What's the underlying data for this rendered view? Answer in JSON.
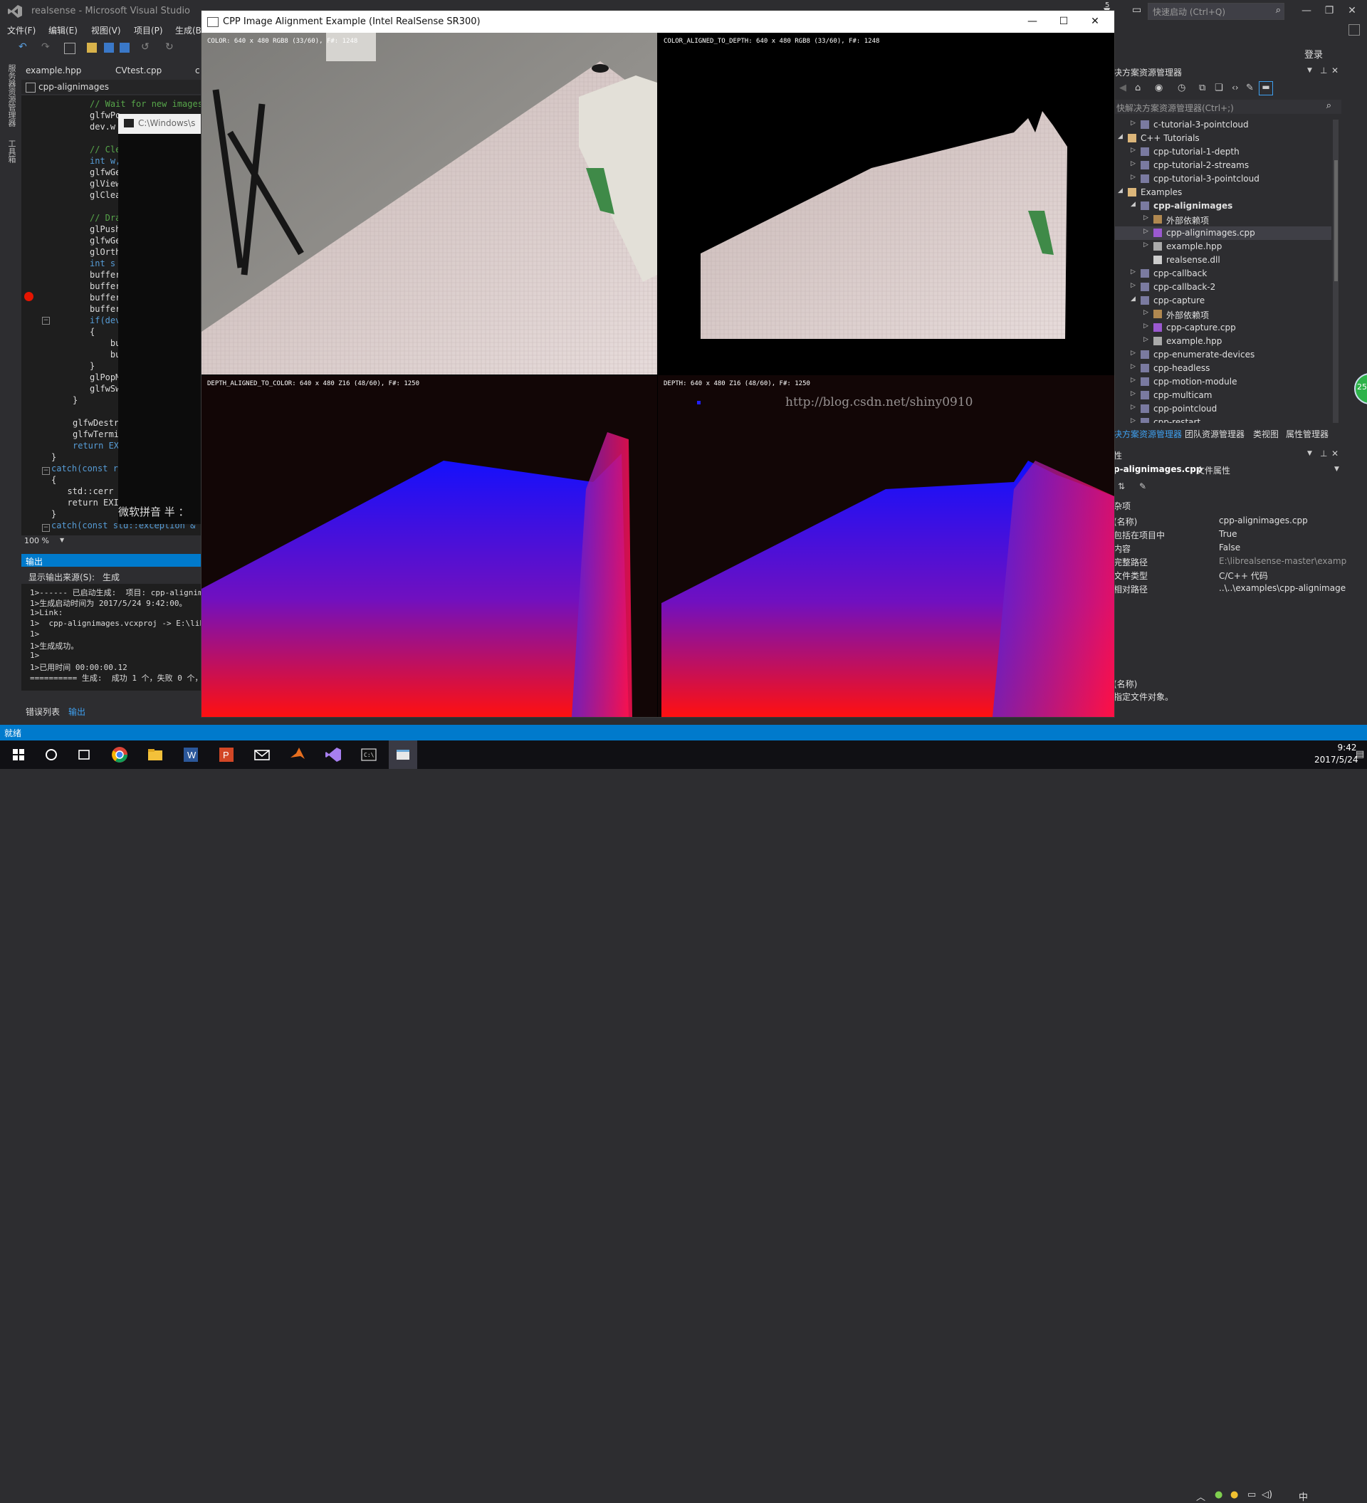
{
  "vs": {
    "title": "realsense - Microsoft Visual Studio",
    "quick_launch_placeholder": "快速启动 (Ctrl+Q)",
    "notification_count": "5",
    "login": "登录",
    "menu": [
      "文件(F)",
      "编辑(E)",
      "视图(V)",
      "项目(P)",
      "生成(B"
    ],
    "left_strip": [
      "服务器资源管理器",
      "工具箱"
    ],
    "doc_tabs": [
      "example.hpp",
      "CVtest.cpp",
      "c"
    ],
    "nav_label": "cpp-alignimages",
    "code_lines": [
      "// Wait for new images",
      "glfwPo",
      "dev.w",
      "",
      "// Cle",
      "int w,",
      "glfwGe",
      "glView",
      "glClea",
      "",
      "// Dra",
      "glPush",
      "glfwGe",
      "glOrth",
      "int s",
      "buffer",
      "buffer",
      "buffer",
      "buffer",
      "if(dev",
      "{",
      "    bu",
      "    bu",
      "}",
      "glPopM",
      "glfwSw",
      "}",
      "",
      "glfwDestro",
      "glfwTermin",
      "return EXI",
      "}",
      "catch(const ra",
      "{",
      "  std::cerr",
      "  return EXI",
      "}",
      "catch(const std::exception & e"
    ],
    "console_chip": "C:\\Windows\\s",
    "ime": "微软拼音 半 ：",
    "zoom": "100 %",
    "output": {
      "title": "输出",
      "source_label": "显示输出来源(S):",
      "source_value": "生成",
      "lines": [
        "1>------ 已启动生成:  项目: cpp-alignim",
        "1>生成启动时间为 2017/5/24 9:42:00。",
        "1>Link:",
        "1>  cpp-alignimages.vcxproj -> E:\\libre",
        "1>",
        "1>生成成功。",
        "1>",
        "1>已用时间 00:00:00.12",
        "========== 生成:  成功 1 个，失败 0 个，"
      ]
    },
    "bottom_tabs": [
      "错误列表",
      "输出"
    ],
    "status": "就绪"
  },
  "solution_explorer": {
    "title": "决方案资源管理器",
    "search_placeholder": "快解决方案资源管理器(Ctrl+;)",
    "items": [
      {
        "label": "c-tutorial-3-pointcloud",
        "level": 1,
        "icon": "project",
        "expanded": false
      },
      {
        "label": "C++ Tutorials",
        "level": 0,
        "icon": "folder",
        "expanded": true
      },
      {
        "label": "cpp-tutorial-1-depth",
        "level": 1,
        "icon": "project",
        "expanded": false
      },
      {
        "label": "cpp-tutorial-2-streams",
        "level": 1,
        "icon": "project",
        "expanded": false
      },
      {
        "label": "cpp-tutorial-3-pointcloud",
        "level": 1,
        "icon": "project",
        "expanded": false
      },
      {
        "label": "Examples",
        "level": 0,
        "icon": "folder",
        "expanded": true
      },
      {
        "label": "cpp-alignimages",
        "level": 1,
        "icon": "project",
        "expanded": true,
        "bold": true
      },
      {
        "label": "外部依赖项",
        "level": 2,
        "icon": "deps",
        "expanded": false
      },
      {
        "label": "cpp-alignimages.cpp",
        "level": 2,
        "icon": "cpp",
        "expanded": false,
        "selected": true
      },
      {
        "label": "example.hpp",
        "level": 2,
        "icon": "file",
        "expanded": false
      },
      {
        "label": "realsense.dll",
        "level": 2,
        "icon": "dll",
        "expanded": null
      },
      {
        "label": "cpp-callback",
        "level": 1,
        "icon": "project",
        "expanded": false
      },
      {
        "label": "cpp-callback-2",
        "level": 1,
        "icon": "project",
        "expanded": false
      },
      {
        "label": "cpp-capture",
        "level": 1,
        "icon": "project",
        "expanded": true
      },
      {
        "label": "外部依赖项",
        "level": 2,
        "icon": "deps",
        "expanded": false
      },
      {
        "label": "cpp-capture.cpp",
        "level": 2,
        "icon": "cpp",
        "expanded": false
      },
      {
        "label": "example.hpp",
        "level": 2,
        "icon": "file",
        "expanded": false
      },
      {
        "label": "cpp-enumerate-devices",
        "level": 1,
        "icon": "project",
        "expanded": false
      },
      {
        "label": "cpp-headless",
        "level": 1,
        "icon": "project",
        "expanded": false
      },
      {
        "label": "cpp-motion-module",
        "level": 1,
        "icon": "project",
        "expanded": false
      },
      {
        "label": "cpp-multicam",
        "level": 1,
        "icon": "project",
        "expanded": false
      },
      {
        "label": "cpp-pointcloud",
        "level": 1,
        "icon": "project",
        "expanded": false
      },
      {
        "label": "cpp-restart",
        "level": 1,
        "icon": "project",
        "expanded": false
      }
    ],
    "tabs": [
      "决方案资源管理器",
      "团队资源管理器",
      "类视图",
      "属性管理器"
    ]
  },
  "properties": {
    "header": "性",
    "title": "p-alignimages.cpp",
    "title_suffix": "文件属性",
    "group": "杂项",
    "rows": [
      {
        "key": "(名称)",
        "value": "cpp-alignimages.cpp"
      },
      {
        "key": "包括在项目中",
        "value": "True"
      },
      {
        "key": "内容",
        "value": "False"
      },
      {
        "key": "完整路径",
        "value": "E:\\librealsense-master\\examp"
      },
      {
        "key": "文件类型",
        "value": "C/C++ 代码"
      },
      {
        "key": "相对路径",
        "value": "..\\..\\examples\\cpp-alignimage"
      }
    ],
    "desc_title": "(名称)",
    "desc_text": "指定文件对象。",
    "badge": "25"
  },
  "realsense": {
    "title": "CPP Image Alignment Example (Intel RealSense SR300)",
    "panes": [
      {
        "label": "COLOR: 640 x 480 RGB8 (33/60), F#: 1248"
      },
      {
        "label": "COLOR_ALIGNED_TO_DEPTH: 640 x 480 RGB8 (33/60), F#: 1248"
      },
      {
        "label": "DEPTH_ALIGNED_TO_COLOR: 640 x 480 Z16 (48/60), F#: 1250"
      },
      {
        "label": "DEPTH: 640 x 480 Z16 (48/60), F#: 1250"
      }
    ],
    "watermark": "http://blog.csdn.net/shiny0910"
  },
  "taskbar": {
    "time": "9:42",
    "date": "2017/5/24",
    "ime": "中"
  },
  "colors": {
    "vs_blue": "#007acc",
    "breakpoint": "#e51400",
    "depth_near": "#ff0000",
    "depth_far": "#0000ff"
  }
}
